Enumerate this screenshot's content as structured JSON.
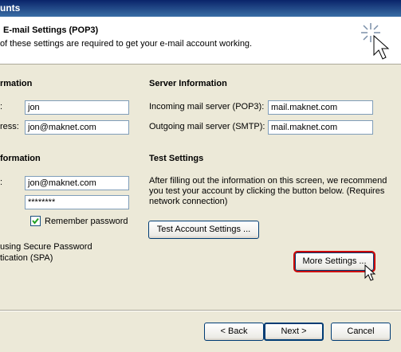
{
  "window": {
    "title": "unts"
  },
  "header": {
    "title": "E-mail Settings (POP3)",
    "subtitle": "of these settings are required to get your e-mail account working."
  },
  "user_info": {
    "heading": "rmation",
    "name_label": ":",
    "name_value": "jon",
    "email_label": "ress:",
    "email_value": "jon@maknet.com"
  },
  "server_info": {
    "heading": "Server Information",
    "incoming_label": "Incoming mail server (POP3):",
    "incoming_value": "mail.maknet.com",
    "outgoing_label": "Outgoing mail server (SMTP):",
    "outgoing_value": "mail.maknet.com"
  },
  "logon_info": {
    "heading": "formation",
    "user_label": ":",
    "user_value": "jon@maknet.com",
    "password_value": "********",
    "remember_label": "Remember password",
    "remember_checked": true,
    "spa_line1": "using Secure Password",
    "spa_line2": "tication (SPA)"
  },
  "test_settings": {
    "heading": "Test Settings",
    "description": "After filling out the information on this screen, we recommend you test your account by clicking the button below. (Requires network connection)",
    "test_button": "Test Account Settings ..."
  },
  "more_settings_button": "More Settings ...",
  "nav": {
    "back": "< Back",
    "next": "Next >",
    "cancel": "Cancel"
  },
  "colors": {
    "highlight": "#cc0000"
  },
  "icons": [
    "wizard-sparkle-cursor-icon",
    "mouse-cursor-icon"
  ]
}
